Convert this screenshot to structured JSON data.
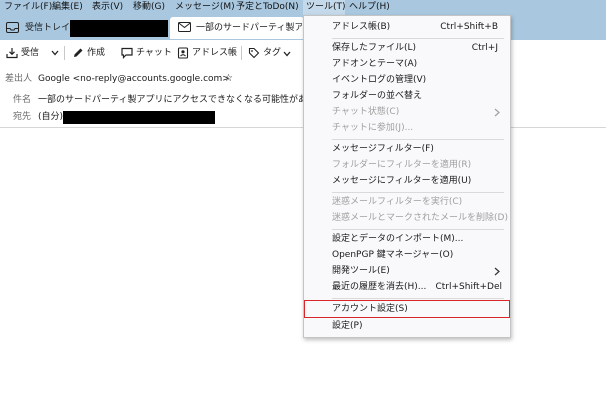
{
  "menubar": {
    "items": [
      {
        "label": "ファイル(F)"
      },
      {
        "label": "編集(E)"
      },
      {
        "label": "表示(V)"
      },
      {
        "label": "移動(G)"
      },
      {
        "label": "メッセージ(M)"
      },
      {
        "label": "予定とToDo(N)"
      },
      {
        "label": "ツール(T)"
      },
      {
        "label": "ヘルプ(H)"
      }
    ]
  },
  "tabs": {
    "inbox_label": "受信トレイ",
    "message_label": "一部のサードパーティ製アプリ"
  },
  "toolbar": {
    "receive": "受信",
    "compose": "作成",
    "chat": "チャット",
    "addressbook": "アドレス帳",
    "tag": "タグ"
  },
  "headers": {
    "from_label": "差出人",
    "from_value": "Google <no-reply@accounts.google.com>",
    "subject_label": "件名",
    "subject_value": "一部のサードパーティ製アプリにアクセスできなくなる可能性があります",
    "to_label": "宛先",
    "to_value": "(自分)"
  },
  "tools_menu": {
    "items": [
      {
        "label": "アドレス帳(B)",
        "shortcut": "Ctrl+Shift+B"
      },
      {
        "label": "保存したファイル(L)",
        "shortcut": "Ctrl+J"
      },
      {
        "label": "アドオンとテーマ(A)",
        "shortcut": ""
      },
      {
        "label": "イベントログの管理(V)",
        "shortcut": ""
      },
      {
        "label": "フォルダーの並べ替え",
        "shortcut": ""
      },
      {
        "label": "チャット状態(C)",
        "shortcut": ""
      },
      {
        "label": "チャットに参加(J)...",
        "shortcut": ""
      },
      {
        "label": "メッセージフィルター(F)",
        "shortcut": ""
      },
      {
        "label": "フォルダーにフィルターを適用(R)",
        "shortcut": ""
      },
      {
        "label": "メッセージにフィルターを適用(U)",
        "shortcut": ""
      },
      {
        "label": "迷惑メールフィルターを実行(C)",
        "shortcut": ""
      },
      {
        "label": "迷惑メールとマークされたメールを削除(D)",
        "shortcut": ""
      },
      {
        "label": "設定とデータのインポート(M)...",
        "shortcut": ""
      },
      {
        "label": "OpenPGP 鍵マネージャー(O)",
        "shortcut": ""
      },
      {
        "label": "開発ツール(E)",
        "shortcut": ""
      },
      {
        "label": "最近の履歴を消去(H)...",
        "shortcut": "Ctrl+Shift+Del"
      },
      {
        "label": "アカウント設定(S)",
        "shortcut": ""
      },
      {
        "label": "設定(P)",
        "shortcut": ""
      }
    ],
    "highlight_color": "#d9262b"
  },
  "colors": {
    "titlebar": "#a9c8e0",
    "menu_bg": "#f9f9fb",
    "accent_red": "#d9262b"
  }
}
